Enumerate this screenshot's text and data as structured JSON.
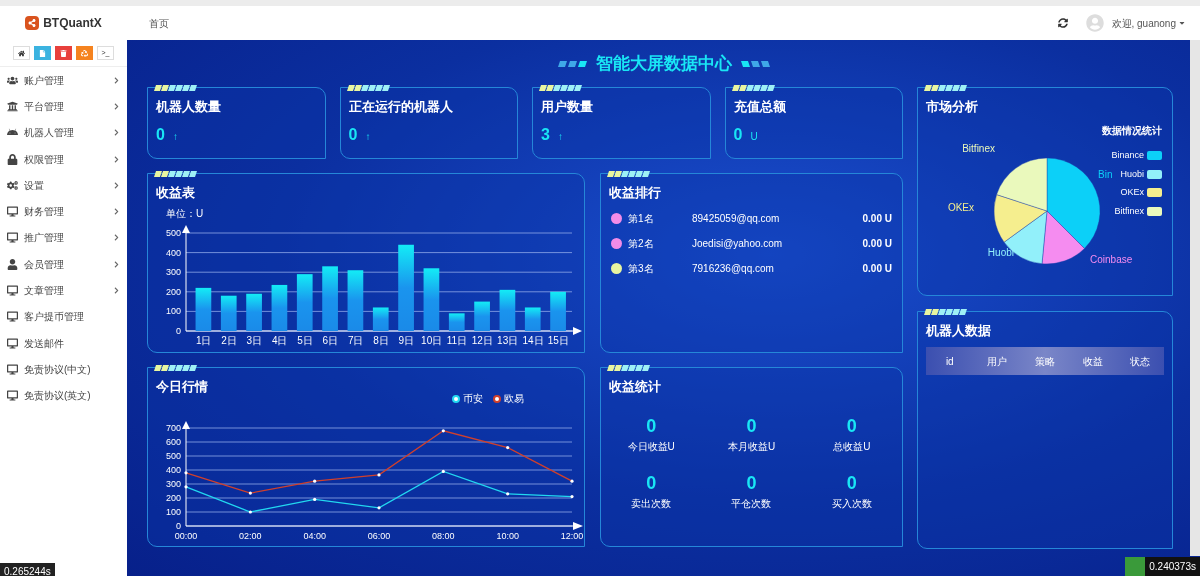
{
  "header": {
    "brand": "BTQuantX",
    "breadcrumb": "首页",
    "welcome": "欢迎, guanong"
  },
  "toolbar": [
    {
      "color": "#ffffff"
    },
    {
      "color": "#3bb3e0"
    },
    {
      "color": "#e8403c"
    },
    {
      "color": "#f5831f"
    },
    {
      "color": "#ffffff",
      "label": ">_"
    }
  ],
  "sidebar": {
    "items": [
      {
        "label": "账户管理",
        "expandable": true
      },
      {
        "label": "平台管理",
        "expandable": true
      },
      {
        "label": "机器人管理",
        "expandable": true
      },
      {
        "label": "权限管理",
        "expandable": true
      },
      {
        "label": "设置",
        "expandable": true
      },
      {
        "label": "财务管理",
        "expandable": true
      },
      {
        "label": "推广管理",
        "expandable": true
      },
      {
        "label": "会员管理",
        "expandable": true
      },
      {
        "label": "文章管理",
        "expandable": true
      },
      {
        "label": "客户提币管理",
        "expandable": false
      },
      {
        "label": "发送邮件",
        "expandable": false
      },
      {
        "label": "免责协议(中文)",
        "expandable": false
      },
      {
        "label": "免责协议(英文)",
        "expandable": false
      }
    ]
  },
  "dashboard_title": "智能大屏数据中心",
  "stat_cards": [
    {
      "title": "机器人数量",
      "value": "0",
      "suffix": "↑"
    },
    {
      "title": "正在运行的机器人",
      "value": "0",
      "suffix": "↑"
    },
    {
      "title": "用户数量",
      "value": "3",
      "suffix": "↑"
    },
    {
      "title": "充值总额",
      "value": "0",
      "suffix": "U"
    }
  ],
  "income_chart": {
    "title": "收益表",
    "chart_data": {
      "type": "bar",
      "ylabel": "单位：U",
      "categories": [
        "1日",
        "2日",
        "3日",
        "4日",
        "5日",
        "6日",
        "7日",
        "8日",
        "9日",
        "10日",
        "11日",
        "12日",
        "13日",
        "14日",
        "15日"
      ],
      "values": [
        220,
        180,
        190,
        235,
        290,
        330,
        310,
        120,
        440,
        320,
        90,
        150,
        210,
        120,
        200
      ],
      "grid": true,
      "ylim": [
        0,
        500
      ],
      "yticks": [
        0,
        100,
        200,
        300,
        400,
        500
      ]
    }
  },
  "market_today": {
    "title": "今日行情",
    "chart_data": {
      "type": "line",
      "x": [
        "00:00",
        "02:00",
        "04:00",
        "06:00",
        "08:00",
        "10:00",
        "12:00"
      ],
      "grid": true,
      "ylim": [
        0,
        700
      ],
      "yticks": [
        0,
        100,
        200,
        300,
        400,
        500,
        600,
        700
      ],
      "series": [
        {
          "name": "币安",
          "color": "#22d8f0",
          "values": [
            280,
            100,
            190,
            130,
            390,
            230,
            210
          ]
        },
        {
          "name": "欧易",
          "color": "#d0402c",
          "values": [
            380,
            235,
            320,
            365,
            680,
            560,
            320
          ]
        }
      ]
    }
  },
  "ranking": {
    "title": "收益排行",
    "rows": [
      {
        "rank": "第1名",
        "color": "#f28ce8",
        "email": "89425059@qq.com",
        "amount": "0.00 U"
      },
      {
        "rank": "第2名",
        "color": "#f28ce8",
        "email": "Joedisi@yahoo.com",
        "amount": "0.00 U"
      },
      {
        "rank": "第3名",
        "color": "#e8f5a0",
        "email": "7916236@qq.com",
        "amount": "0.00 U"
      }
    ]
  },
  "income_stats": {
    "title": "收益统计",
    "items": [
      {
        "value": "0",
        "label": "今日收益U"
      },
      {
        "value": "0",
        "label": "本月收益U"
      },
      {
        "value": "0",
        "label": "总收益U"
      },
      {
        "value": "0",
        "label": "卖出次数"
      },
      {
        "value": "0",
        "label": "平仓次数"
      },
      {
        "value": "0",
        "label": "买入次数"
      }
    ]
  },
  "market_analysis": {
    "title": "市场分析",
    "legend_title": "数据情况统计",
    "legend": [
      {
        "label": "Binance",
        "color": "#0cd0f8"
      },
      {
        "label": "Huobi",
        "color": "#92f0fa"
      },
      {
        "label": "OKEx",
        "color": "#f5ee8e"
      },
      {
        "label": "Bitfinex",
        "color": "#eaf9bc"
      }
    ],
    "slices": [
      {
        "label": "Bin",
        "color": "#0cd0f8"
      },
      {
        "label": "Coinbase",
        "color": "#f58cf0"
      },
      {
        "label": "Huobi",
        "color": "#92f0fa"
      },
      {
        "label": "OKEx",
        "color": "#f5ee8e"
      },
      {
        "label": "Bitfinex",
        "color": "#eaf9bc"
      }
    ]
  },
  "robot_data": {
    "title": "机器人数据",
    "columns": [
      "id",
      "用户",
      "策略",
      "收益",
      "状态"
    ]
  },
  "timings": [
    "0.265244s",
    "0.240373s"
  ]
}
